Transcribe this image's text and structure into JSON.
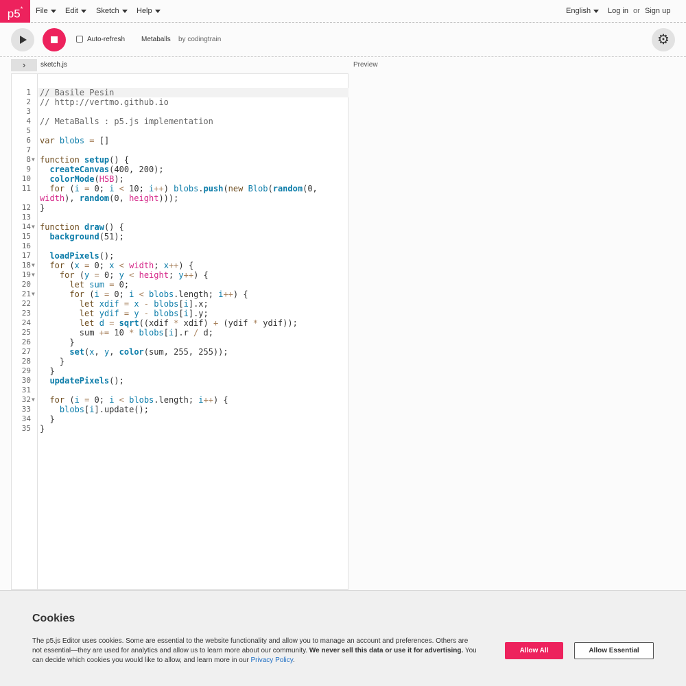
{
  "nav": {
    "logo": "p5",
    "logo_sup": "*",
    "menus": [
      "File",
      "Edit",
      "Sketch",
      "Help"
    ],
    "language": "English",
    "login": "Log in",
    "or": "or",
    "signup": "Sign up"
  },
  "toolbar": {
    "autorefresh_label": "Auto-refresh",
    "sketch_name": "Metaballs",
    "author": "by codingtrain",
    "gear_glyph": "⚙"
  },
  "subheader": {
    "toggle_glyph": "›",
    "filename": "sketch.js",
    "preview": "Preview"
  },
  "editor": {
    "code_lines": [
      {
        "num": "1",
        "fold": false,
        "html": "<span class=\"cmt\">// Basile Pesin</span>"
      },
      {
        "num": "2",
        "fold": false,
        "html": "<span class=\"cmt\">// http://vertmo.github.io</span>"
      },
      {
        "num": "3",
        "fold": false,
        "html": ""
      },
      {
        "num": "4",
        "fold": false,
        "html": "<span class=\"cmt\">// MetaBalls : p5.js implementation</span>"
      },
      {
        "num": "5",
        "fold": false,
        "html": ""
      },
      {
        "num": "6",
        "fold": false,
        "html": "<span class=\"kw\">var</span> <span class=\"var\">blobs</span> <span class=\"op\">=</span> []"
      },
      {
        "num": "7",
        "fold": false,
        "html": ""
      },
      {
        "num": "8",
        "fold": true,
        "html": "<span class=\"kw\">function</span> <span class=\"fn\">setup</span>() {"
      },
      {
        "num": "9",
        "fold": false,
        "html": "  <span class=\"fn\">createCanvas</span>(400, 200);"
      },
      {
        "num": "10",
        "fold": false,
        "html": "  <span class=\"fn\">colorMode</span>(<span class=\"bi\">HSB</span>);"
      },
      {
        "num": "11",
        "fold": false,
        "html": "  <span class=\"kw\">for</span> (<span class=\"var\">i</span> <span class=\"op\">=</span> 0; <span class=\"var\">i</span> <span class=\"op\">&lt;</span> 10; <span class=\"var\">i</span><span class=\"op\">++</span>) <span class=\"var\">blobs</span>.<span class=\"fn\">push</span>(<span class=\"kw\">new</span> <span class=\"var\">Blob</span>(<span class=\"fn\">random</span>(0,"
      },
      {
        "num": "",
        "fold": false,
        "html": "<span class=\"bi\">width</span>), <span class=\"fn\">random</span>(0, <span class=\"bi\">height</span>)));"
      },
      {
        "num": "12",
        "fold": false,
        "html": "}"
      },
      {
        "num": "13",
        "fold": false,
        "html": ""
      },
      {
        "num": "14",
        "fold": true,
        "html": "<span class=\"kw\">function</span> <span class=\"fn\">draw</span>() {"
      },
      {
        "num": "15",
        "fold": false,
        "html": "  <span class=\"fn\">background</span>(51);"
      },
      {
        "num": "16",
        "fold": false,
        "html": ""
      },
      {
        "num": "17",
        "fold": false,
        "html": "  <span class=\"fn\">loadPixels</span>();"
      },
      {
        "num": "18",
        "fold": true,
        "html": "  <span class=\"kw\">for</span> (<span class=\"var\">x</span> <span class=\"op\">=</span> 0; <span class=\"var\">x</span> <span class=\"op\">&lt;</span> <span class=\"bi\">width</span>; <span class=\"var\">x</span><span class=\"op\">++</span>) {"
      },
      {
        "num": "19",
        "fold": true,
        "html": "    <span class=\"kw\">for</span> (<span class=\"var\">y</span> <span class=\"op\">=</span> 0; <span class=\"var\">y</span> <span class=\"op\">&lt;</span> <span class=\"bi\">height</span>; <span class=\"var\">y</span><span class=\"op\">++</span>) {"
      },
      {
        "num": "20",
        "fold": false,
        "html": "      <span class=\"kw\">let</span> <span class=\"var\">sum</span> <span class=\"op\">=</span> 0;"
      },
      {
        "num": "21",
        "fold": true,
        "html": "      <span class=\"kw\">for</span> (<span class=\"var\">i</span> <span class=\"op\">=</span> 0; <span class=\"var\">i</span> <span class=\"op\">&lt;</span> <span class=\"var\">blobs</span>.length; <span class=\"var\">i</span><span class=\"op\">++</span>) {"
      },
      {
        "num": "22",
        "fold": false,
        "html": "        <span class=\"kw\">let</span> <span class=\"var\">xdif</span> <span class=\"op\">=</span> <span class=\"var\">x</span> <span class=\"op\">-</span> <span class=\"var\">blobs</span>[<span class=\"var\">i</span>].x;"
      },
      {
        "num": "23",
        "fold": false,
        "html": "        <span class=\"kw\">let</span> <span class=\"var\">ydif</span> <span class=\"op\">=</span> <span class=\"var\">y</span> <span class=\"op\">-</span> <span class=\"var\">blobs</span>[<span class=\"var\">i</span>].y;"
      },
      {
        "num": "24",
        "fold": false,
        "html": "        <span class=\"kw\">let</span> <span class=\"var\">d</span> <span class=\"op\">=</span> <span class=\"fn\">sqrt</span>((xdif <span class=\"op\">*</span> xdif) <span class=\"op\">+</span> (ydif <span class=\"op\">*</span> ydif));"
      },
      {
        "num": "25",
        "fold": false,
        "html": "        sum <span class=\"op\">+=</span> 10 <span class=\"op\">*</span> <span class=\"var\">blobs</span>[<span class=\"var\">i</span>].r <span class=\"op\">/</span> d;"
      },
      {
        "num": "26",
        "fold": false,
        "html": "      }"
      },
      {
        "num": "27",
        "fold": false,
        "html": "      <span class=\"fn\">set</span>(<span class=\"var\">x</span>, <span class=\"var\">y</span>, <span class=\"fn\">color</span>(sum, 255, 255));"
      },
      {
        "num": "28",
        "fold": false,
        "html": "    }"
      },
      {
        "num": "29",
        "fold": false,
        "html": "  }"
      },
      {
        "num": "30",
        "fold": false,
        "html": "  <span class=\"fn\">updatePixels</span>();"
      },
      {
        "num": "31",
        "fold": false,
        "html": ""
      },
      {
        "num": "32",
        "fold": true,
        "html": "  <span class=\"kw\">for</span> (<span class=\"var\">i</span> <span class=\"op\">=</span> 0; <span class=\"var\">i</span> <span class=\"op\">&lt;</span> <span class=\"var\">blobs</span>.length; <span class=\"var\">i</span><span class=\"op\">++</span>) {"
      },
      {
        "num": "33",
        "fold": false,
        "html": "    <span class=\"var\">blobs</span>[<span class=\"var\">i</span>].update();"
      },
      {
        "num": "34",
        "fold": false,
        "html": "  }"
      },
      {
        "num": "35",
        "fold": false,
        "html": "}"
      }
    ]
  },
  "cookies": {
    "title": "Cookies",
    "text_1": "The p5.js Editor uses cookies. Some are essential to the website functionality and allow you to manage an account and preferences. Others are not essential—they are used for analytics and allow us to learn more about our community. ",
    "text_bold": "We never sell this data or use it for advertising.",
    "text_2": " You can decide which cookies you would like to allow, and learn more in our ",
    "privacy_link": "Privacy Policy",
    "text_end": ".",
    "allow_all": "Allow All",
    "allow_essential": "Allow Essential"
  },
  "colors": {
    "accent": "#ed225d",
    "link": "#1f6fc4"
  }
}
